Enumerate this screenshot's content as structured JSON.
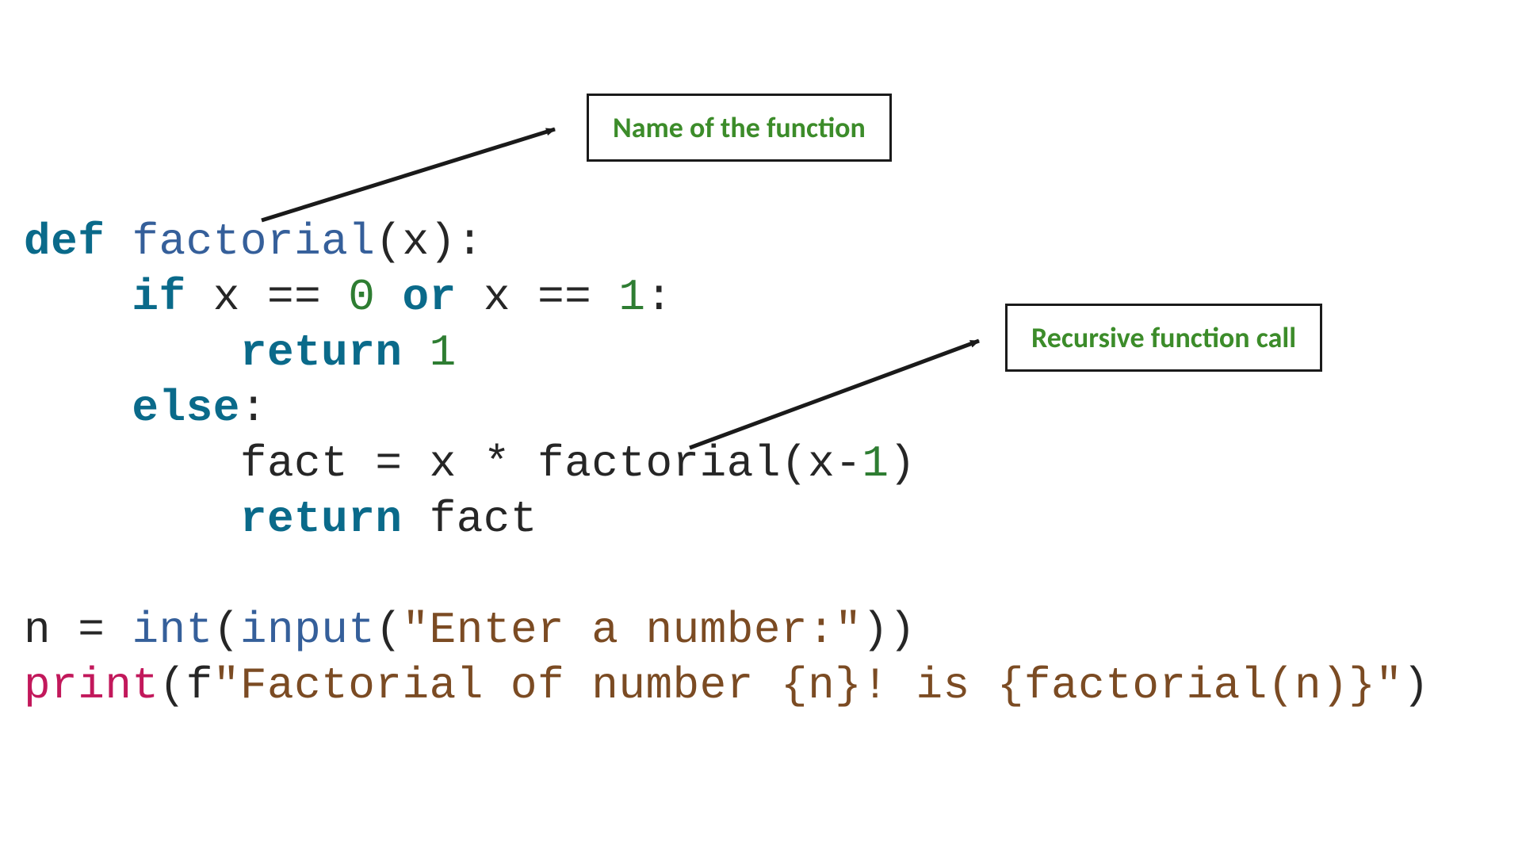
{
  "callouts": {
    "fn_name": "Name of the function",
    "recursive_call": "Recursive function call"
  },
  "code": {
    "l1": {
      "def": "def",
      "sp1": " ",
      "factorial": "factorial",
      "rest": "(x):"
    },
    "l2": {
      "indent": "    ",
      "if": "if",
      "sp1": " x ",
      "eq1": "==",
      "sp2": " ",
      "zero": "0",
      "sp3": " ",
      "or": "or",
      "sp4": " x ",
      "eq2": "==",
      "sp5": " ",
      "one": "1",
      "colon": ":"
    },
    "l3": {
      "indent": "        ",
      "return": "return",
      "sp1": " ",
      "one": "1"
    },
    "l4": {
      "indent": "    ",
      "else": "else",
      "colon": ":"
    },
    "l5": {
      "indent": "        ",
      "fact": "fact ",
      "eq": "=",
      "sp1": " x ",
      "star": "*",
      "sp2": " ",
      "call": "factorial(x",
      "minus": "-",
      "one": "1",
      "close": ")"
    },
    "l6": {
      "indent": "        ",
      "return": "return",
      "sp1": " fact"
    },
    "blank": "",
    "l7": {
      "n": "n ",
      "eq": "=",
      "sp": " ",
      "int": "int",
      "open": "(",
      "input": "input",
      "rest1": "(",
      "str": "\"Enter a number:\"",
      "rest2": "))"
    },
    "l8": {
      "print": "print",
      "open": "(f",
      "str1": "\"Factorial of number ",
      "brace1": "{n}",
      "str2": "! is ",
      "brace2": "{factorial(n)}",
      "str3": "\"",
      "close": ")"
    }
  }
}
